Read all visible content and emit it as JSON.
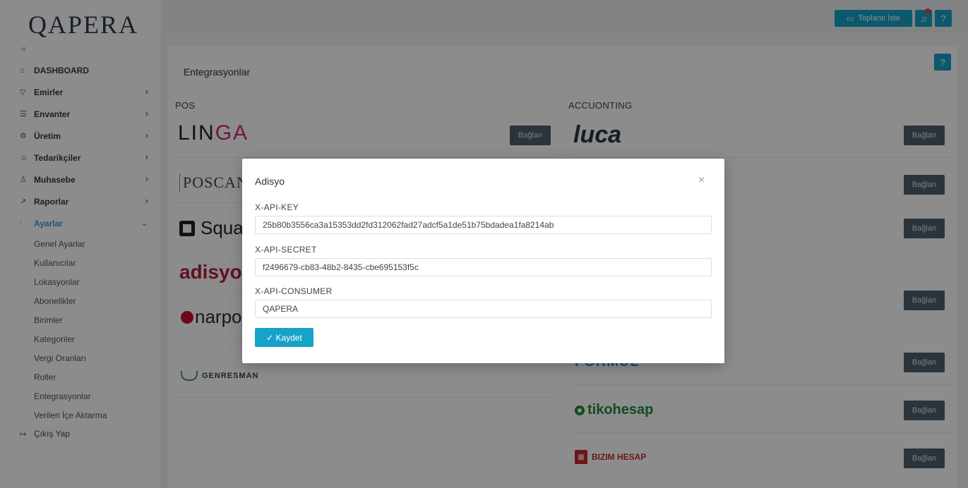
{
  "app": {
    "logo": "QAPERA",
    "collapse_icon": "«"
  },
  "sidebar": {
    "items": [
      {
        "icon": "home-icon",
        "glyph": "⌂",
        "label": "DASHBOARD"
      },
      {
        "icon": "cart-icon",
        "glyph": "▽",
        "label": "Emirler"
      },
      {
        "icon": "list-icon",
        "glyph": "☰",
        "label": "Envanter"
      },
      {
        "icon": "gear-icon",
        "glyph": "⚙",
        "label": "Üretim"
      },
      {
        "icon": "users-icon",
        "glyph": "☺",
        "label": "Tedarikçiler"
      },
      {
        "icon": "user-icon",
        "glyph": "♙",
        "label": "Muhasebe"
      },
      {
        "icon": "chart-icon",
        "glyph": "↗",
        "label": "Raporlar"
      },
      {
        "icon": "settings-icon",
        "glyph": "⫶",
        "label": "Ayarlar"
      }
    ],
    "sub_items": [
      "Genel Ayarlar",
      "Kullanıcılar",
      "Lokasyonlar",
      "Abonelikler",
      "Birimler",
      "Kategoriler",
      "Vergi Oranları",
      "Roller",
      "Entegrasyonlar",
      "Verileri İçe Aktarma"
    ],
    "logout": {
      "glyph": "↦",
      "label": "Çıkış Yap"
    },
    "chevron_right": "›",
    "chevron_down": "⌄"
  },
  "topbar": {
    "meeting_label": "Toplantı İste",
    "meeting_glyph": "▭",
    "bell_glyph": "♫",
    "help_glyph": "?"
  },
  "page": {
    "title": "Entegrasyonlar",
    "help_glyph": "?",
    "pos_title": "POS",
    "accounting_title": "ACCUONTING",
    "connect_label": "Bağlan",
    "pos_brands": {
      "linga_a": "LIN",
      "linga_b": "GA",
      "poscan": "POSCAN",
      "square": "Square",
      "adisyo": "adisyo",
      "narpos": "narpos",
      "genresman": "GENRESMAN"
    },
    "acc_brands": {
      "luca": "luca",
      "formul": "FORMÜL",
      "tiko": "tikohesap",
      "bizim": "BIZIM HESAP"
    }
  },
  "modal": {
    "title": "Adisyo",
    "close_glyph": "×",
    "fields": [
      {
        "label": "X-API-KEY",
        "value": "25b80b3556ca3a15353dd2fd312062fad27adcf5a1de51b75bdadea1fa8214ab"
      },
      {
        "label": "X-API-SECRET",
        "value": "f2496679-cb83-48b2-8435-cbe695153f5c"
      },
      {
        "label": "X-API-CONSUMER",
        "value": "QAPERA"
      }
    ],
    "save_label": "✓  Kaydet"
  },
  "colors": {
    "accent": "#17a2c8",
    "connect_button": "#4d6070",
    "overlay": "rgba(0,0,0,0.45)"
  }
}
